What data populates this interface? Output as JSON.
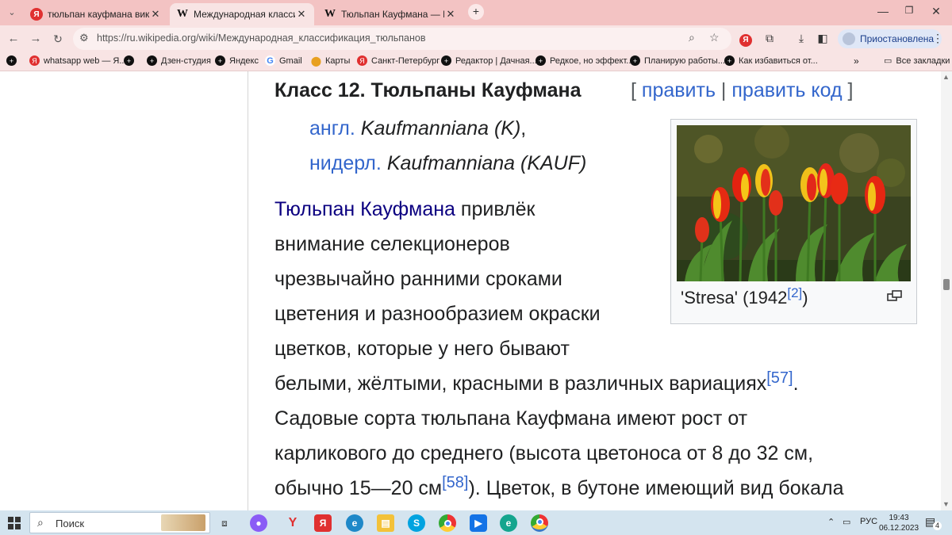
{
  "browser": {
    "tabs": [
      {
        "title": "тюльпан кауфмана википедия",
        "favicon": "yandex-icon"
      },
      {
        "title": "Международная классификация",
        "favicon": "wikipedia-icon"
      },
      {
        "title": "Тюльпан Кауфмана — Википедия",
        "favicon": "wikipedia-icon"
      }
    ],
    "url": "https://ru.wikipedia.org/wiki/Международная_классификация_тюльпанов",
    "profile_label": "Приостановлена",
    "bookmarks": [
      {
        "label": "whatsapp web — Я...",
        "icon": "yandex-icon"
      },
      {
        "label": "",
        "icon": "plus-circle-icon"
      },
      {
        "label": "Дзен-студия",
        "icon": "plus-circle-icon"
      },
      {
        "label": "Яндекс",
        "icon": "plus-circle-icon"
      },
      {
        "label": "Gmail",
        "icon": "google-icon"
      },
      {
        "label": "Карты",
        "icon": "map-pin-icon"
      },
      {
        "label": "Санкт-Петербург",
        "icon": "yandex-icon"
      },
      {
        "label": "Редактор | Дачная...",
        "icon": "plus-circle-icon"
      },
      {
        "label": "Редкое, но эффект...",
        "icon": "plus-circle-icon"
      },
      {
        "label": "Планирую работы...",
        "icon": "plus-circle-icon"
      },
      {
        "label": "Как избавиться от...",
        "icon": "plus-circle-icon"
      }
    ],
    "all_bookmarks_label": "Все закладки",
    "colors": {
      "tabbar": "#f3c3c3",
      "toolbar": "#f8e4e4",
      "link": "#3366cc"
    }
  },
  "article": {
    "heading": "Класс 12. Тюльпаны Кауфмана",
    "edit_open": "[ ",
    "edit_label": "править",
    "edit_sep": " | ",
    "edit_code_label": "править код",
    "edit_close": " ]",
    "alt_names": [
      {
        "lang": "англ.",
        "name": "Kaufmanniana (K)",
        "suffix": ","
      },
      {
        "lang": "нидерл.",
        "name": "Kaufmanniana (KAUF)",
        "suffix": ""
      }
    ],
    "lines": [
      {
        "link": "Тюльпан Кауфмана",
        "text": " привлёк"
      },
      {
        "text": "внимание селекционеров"
      },
      {
        "text": "чрезвычайно ранними сроками"
      },
      {
        "text": "цветения и разнообразием окраски"
      },
      {
        "text": "цветков, которые у него бывают"
      },
      {
        "text": "белыми, жёлтыми, красными в различных вариациях",
        "ref": "[57]",
        "tail": "."
      },
      {
        "text": "Садовые сорта тюльпана Кауфмана имеют рост от"
      },
      {
        "text": "карликового до среднего (высота цветоноса от 8 до 32 см,"
      },
      {
        "text": "обычно 15—20 см",
        "ref": "[58]",
        "tail": "). Цветок, в бутоне имеющий вид бокала"
      }
    ],
    "figure": {
      "caption": "'Stresa' (1942",
      "ref": "[2]",
      "caption_tail": ")"
    }
  },
  "taskbar": {
    "search_placeholder": "Поиск",
    "lang": "РУС",
    "time": "19:43",
    "date": "06.12.2023",
    "notifications": "4"
  }
}
